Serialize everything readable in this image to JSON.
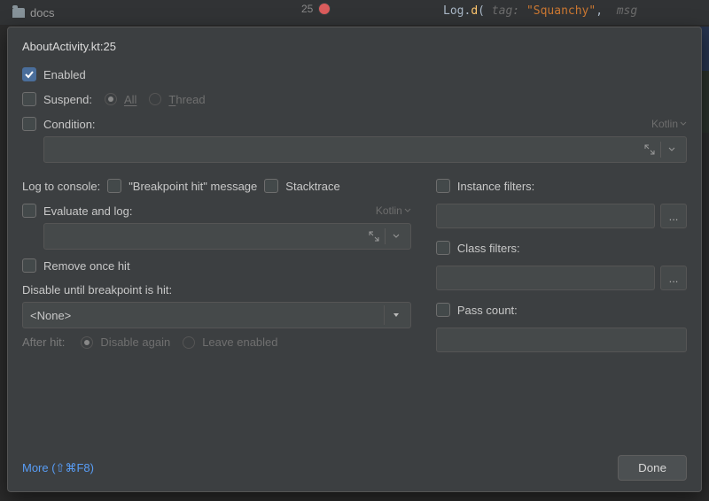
{
  "background": {
    "folder": "docs",
    "line_number": "25",
    "code_prefix": "Log",
    "code_method": "d",
    "hint_tag": "tag:",
    "string_literal": "\"Squanchy\"",
    "hint_msg": "msg"
  },
  "panel": {
    "title": "AboutActivity.kt:25",
    "enabled_label": "Enabled",
    "suspend_label": "Suspend:",
    "suspend_all": "All",
    "suspend_thread": "Thread",
    "condition_label": "Condition:",
    "condition_lang": "Kotlin",
    "log_label": "Log to console:",
    "bp_hit_label": "\"Breakpoint hit\" message",
    "stacktrace_label": "Stacktrace",
    "eval_label": "Evaluate and log:",
    "eval_lang": "Kotlin",
    "remove_label": "Remove once hit",
    "disable_until_label": "Disable until breakpoint is hit:",
    "disable_until_value": "<None>",
    "after_hit_label": "After hit:",
    "after_disable": "Disable again",
    "after_leave": "Leave enabled",
    "instance_filters": "Instance filters:",
    "class_filters": "Class filters:",
    "pass_count": "Pass count:",
    "more_link": "More (⇧⌘F8)",
    "done_label": "Done",
    "dots": "..."
  }
}
